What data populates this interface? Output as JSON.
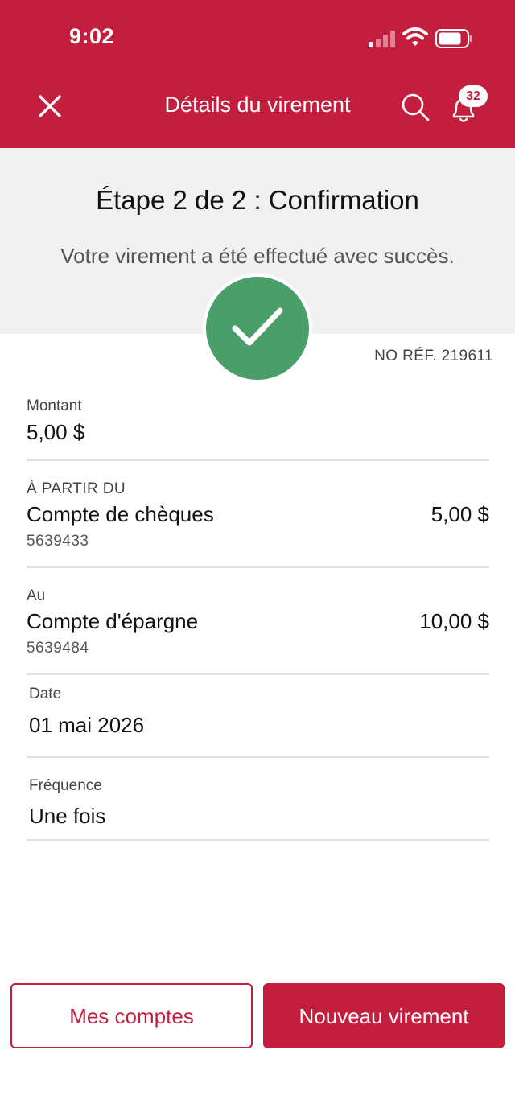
{
  "status_bar": {
    "time": "9:02"
  },
  "nav": {
    "title": "Détails du virement",
    "notification_count": "32",
    "icons": {
      "close": "close-icon",
      "search": "search-icon",
      "bell": "bell-icon"
    }
  },
  "hero": {
    "step_title": "Étape 2 de 2 : Confirmation",
    "message": "Votre virement a été effectué avec succès."
  },
  "reference": "NO RÉF. 219611",
  "details": {
    "amount": {
      "label": "Montant",
      "value": "5,00 $"
    },
    "from": {
      "label": "À PARTIR DU",
      "account": "Compte de chèques",
      "number": "5639433",
      "balance": "5,00 $"
    },
    "to": {
      "label": "Au",
      "account": "Compte d'épargne",
      "number": "5639484",
      "balance": "10,00 $"
    },
    "date": {
      "label": "Date",
      "value": "01 mai 2026"
    },
    "frequency": {
      "label": "Fréquence",
      "value": "Une fois"
    }
  },
  "actions": {
    "my_accounts": "Mes comptes",
    "new_transfer": "Nouveau virement"
  },
  "colors": {
    "brand": "#c41e3f",
    "success": "#4a9e6a",
    "hero_bg": "#f1f1f1"
  }
}
